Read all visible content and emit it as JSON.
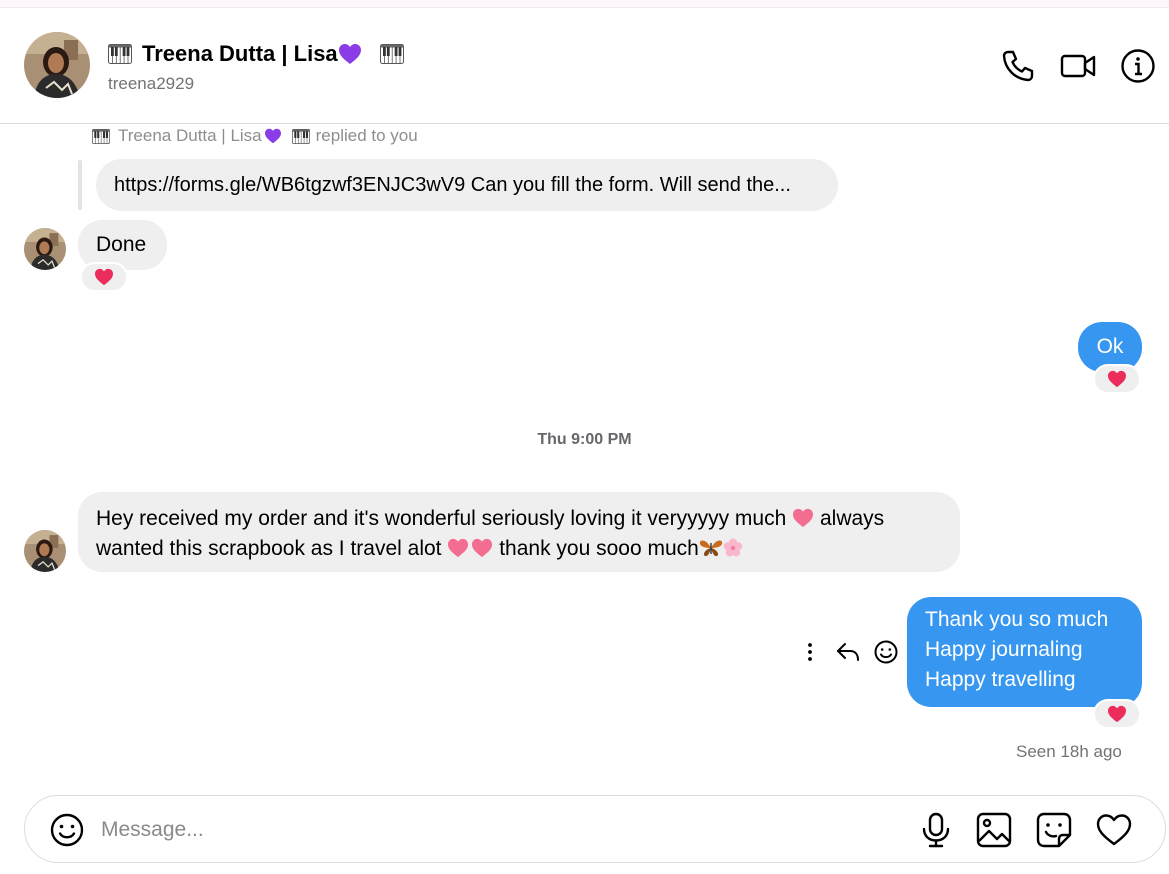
{
  "colors": {
    "outgoing_bubble": "#3797f0",
    "incoming_bubble": "#efefef",
    "reaction_heart": "#ec2d5c",
    "muted_text": "#737373"
  },
  "header": {
    "display_name": "Treena Dutta | Lisa",
    "username": "treena2929",
    "name_decorations": [
      "piano-emoji",
      "purple-heart-emoji",
      "piano-emoji"
    ],
    "actions": [
      "phone-icon",
      "video-camera-icon",
      "info-icon"
    ]
  },
  "thread": {
    "reply_context": {
      "sender": "Treena Dutta | Lisa",
      "action_text": "replied to you",
      "quoted_text": "https://forms.gle/WB6tgzwf3ENJC3wV9 Can you fill the form. Will send the..."
    },
    "messages": [
      {
        "id": "m1",
        "direction": "incoming",
        "text": "Done",
        "reaction": "red-heart-emoji"
      },
      {
        "id": "m2",
        "direction": "outgoing",
        "text": "Ok",
        "reaction": "red-heart-emoji"
      },
      {
        "id": "m3",
        "direction": "incoming",
        "line1_part1": "Hey received my order and it's wonderful seriously loving it veryyyyy much",
        "line1_part2": "always",
        "line2_part1": "wanted this scrapbook as I travel alot",
        "line2_part2": "thank you sooo much",
        "emojis": [
          "heart-emoji",
          "heart-emoji",
          "heart-emoji",
          "butterfly-emoji",
          "cherry-blossom-emoji"
        ]
      },
      {
        "id": "m4",
        "direction": "outgoing",
        "lines": [
          "Thank you so much",
          "Happy journaling",
          "Happy travelling"
        ],
        "reaction": "red-heart-emoji"
      }
    ],
    "timestamp": "Thu 9:00 PM",
    "seen_status": "Seen 18h ago",
    "hover_actions": [
      "more-options-icon",
      "reply-icon",
      "react-icon"
    ]
  },
  "composer": {
    "placeholder": "Message...",
    "value": "",
    "actions": [
      "emoji-icon",
      "microphone-icon",
      "image-icon",
      "sticker-icon",
      "heart-icon"
    ]
  }
}
